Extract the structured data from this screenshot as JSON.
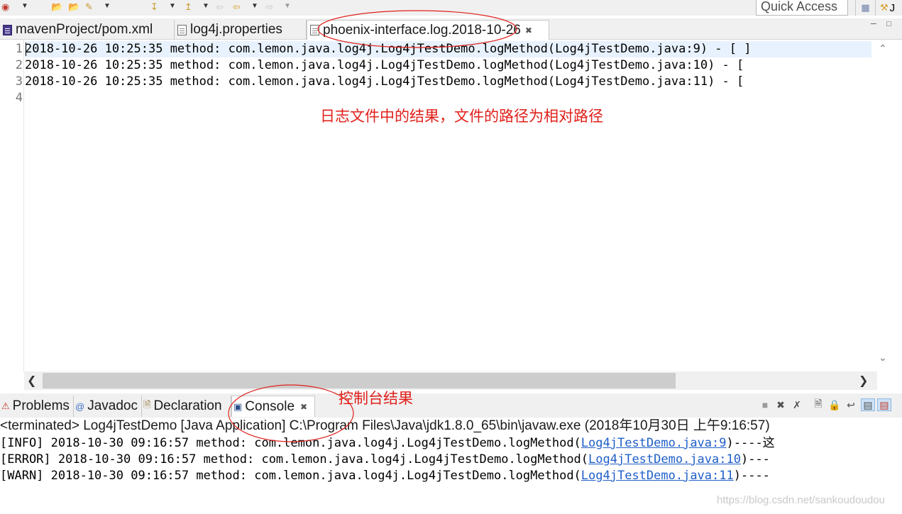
{
  "toolbar": {
    "quick_access_label": "Quick Access",
    "buttons": [
      "new-icon",
      "open-folder-icon",
      "open-folder-2-icon",
      "pin-icon",
      "download-icon",
      "up-icon",
      "back-icon",
      "back-2-icon",
      "forward-icon"
    ]
  },
  "editor_tabs": [
    {
      "label": "mavenProject/pom.xml",
      "icon": "xml-file-icon"
    },
    {
      "label": "log4j.properties",
      "icon": "text-file-icon"
    },
    {
      "label": "phoenix-interface.log.2018-10-26",
      "icon": "text-file-icon",
      "active": true
    }
  ],
  "editor": {
    "line_numbers": [
      "1",
      "2",
      "3",
      "4"
    ],
    "lines": [
      "2018-10-26 10:25:35 method: com.lemon.java.log4j.Log4jTestDemo.logMethod(Log4jTestDemo.java:9) - [ ]",
      "2018-10-26 10:25:35 method: com.lemon.java.log4j.Log4jTestDemo.logMethod(Log4jTestDemo.java:10) - [",
      "2018-10-26 10:25:35 method: com.lemon.java.log4j.Log4jTestDemo.logMethod(Log4jTestDemo.java:11) - [",
      ""
    ]
  },
  "annotations": {
    "log_file_note": "日志文件中的结果，文件的路径为相对路径",
    "console_note": "控制台结果"
  },
  "view_tabs": [
    {
      "label": "Problems",
      "icon": "problems-icon"
    },
    {
      "label": "Javadoc",
      "icon": "javadoc-icon"
    },
    {
      "label": "Declaration",
      "icon": "declaration-icon"
    },
    {
      "label": "Console",
      "icon": "console-icon",
      "active": true
    }
  ],
  "console": {
    "terminated_label": "<terminated> Log4jTestDemo [Java Application] C:\\Program Files\\Java\\jdk1.8.0_65\\bin\\javaw.exe (2018年10月30日 上午9:16:57)",
    "lines": [
      {
        "prefix": "[INFO] 2018-10-30 09:16:57 method: com.lemon.java.log4j.Log4jTestDemo.logMethod(",
        "link": "Log4jTestDemo.java:9",
        "suffix": ")----这"
      },
      {
        "prefix": "[ERROR] 2018-10-30 09:16:57 method: com.lemon.java.log4j.Log4jTestDemo.logMethod(",
        "link": "Log4jTestDemo.java:10",
        "suffix": ")---"
      },
      {
        "prefix": "[WARN] 2018-10-30 09:16:57 method: com.lemon.java.log4j.Log4jTestDemo.logMethod(",
        "link": "Log4jTestDemo.java:11",
        "suffix": ")----"
      }
    ]
  },
  "watermark": "https://blog.csdn.net/sankoudoudou"
}
